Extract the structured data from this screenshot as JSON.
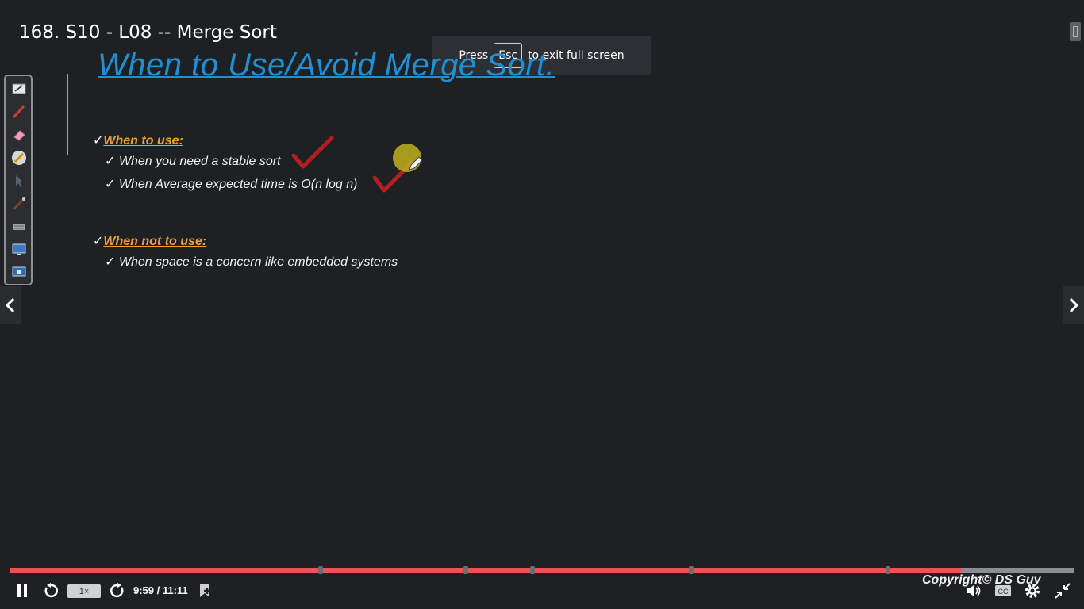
{
  "player": {
    "lecture_title": "168. S10 - L08 -- Merge Sort",
    "fullscreen_notice": {
      "prefix": "Press",
      "key": "Esc",
      "suffix": "to exit full screen"
    },
    "speed_label": "1×",
    "time_display": "9:59 / 11:11",
    "progress": 0.894,
    "chapter_markers": [
      0.292,
      0.428,
      0.491,
      0.64,
      0.825
    ],
    "accent_color": "#ec5252"
  },
  "slide": {
    "heading": "When to Use/Avoid Merge Sort.",
    "heading_color": "#1f8fd6",
    "section_color": "#f2a02b",
    "check_mark": "✓",
    "sections": [
      {
        "label": "When to use:",
        "items": [
          "When you need a stable sort",
          "When Average expected time is O(n log n)"
        ]
      },
      {
        "label": "When not to use:",
        "items": [
          "When space is a concern like embedded systems"
        ]
      }
    ],
    "copyright": "Copyright© DS Guy"
  },
  "toolbar_tools": [
    "notepad-icon",
    "pen-icon",
    "eraser-icon",
    "highlighter-icon",
    "pointer-icon",
    "brush-icon",
    "keyboard-icon",
    "screen-icon",
    "presentation-icon"
  ],
  "controls": [
    "pause-icon",
    "rewind-icon",
    "forward-icon",
    "add-note-icon",
    "volume-icon",
    "captions-icon",
    "settings-icon",
    "exit-fullscreen-icon"
  ]
}
